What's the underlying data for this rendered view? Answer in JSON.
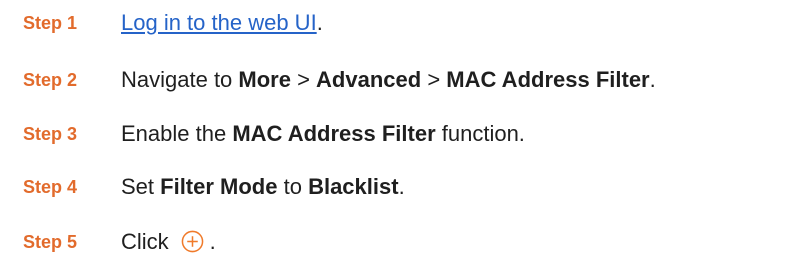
{
  "steps": [
    {
      "label": "Step 1",
      "link_text": "Log in to the web UI",
      "after": "."
    },
    {
      "label": "Step 2",
      "pre": "Navigate to ",
      "b1": "More",
      "sep1": " > ",
      "b2": "Advanced",
      "sep2": " > ",
      "b3": "MAC Address Filter",
      "after": "."
    },
    {
      "label": "Step 3",
      "pre": "Enable the ",
      "b1": "MAC Address Filter",
      "after": " function."
    },
    {
      "label": "Step 4",
      "pre": "Set ",
      "b1": "Filter Mode",
      "mid": " to ",
      "b2": "Blacklist",
      "after": "."
    },
    {
      "label": "Step 5",
      "pre": "Click",
      "icon": "plus-circle-icon",
      "after": "."
    }
  ],
  "colors": {
    "step_label": "#e26b2c",
    "link": "#2563c8",
    "icon": "#f07a2a"
  }
}
